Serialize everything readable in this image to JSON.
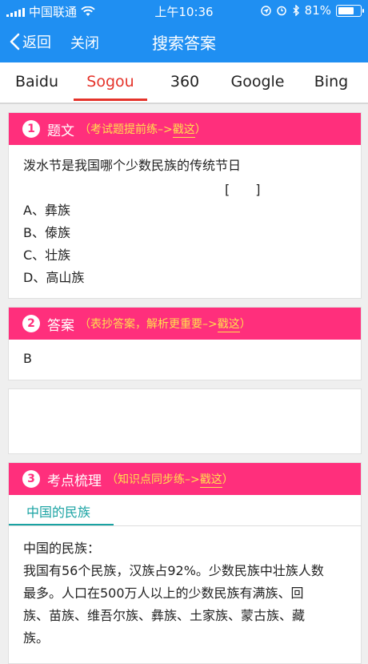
{
  "status_bar": {
    "carrier": "中国联通",
    "time": "上午10:36",
    "battery": "81%",
    "battery_level": 0.81
  },
  "nav": {
    "back_label": "返回",
    "close_label": "关闭",
    "title": "搜索答案"
  },
  "tabs": [
    "Baidu",
    "Sogou",
    "360",
    "Google",
    "Bing"
  ],
  "active_tab": "Sogou",
  "question_card": {
    "number": "1",
    "title": "题文",
    "hint_prefix": "（考试题提前练–>",
    "hint_link": "戳这",
    "hint_suffix": "）",
    "text": "泼水节是我国哪个少数民族的传统节日",
    "blank": "[　　]",
    "options": [
      "A、彝族",
      "B、傣族",
      "C、壮族",
      "D、高山族"
    ]
  },
  "answer_card": {
    "number": "2",
    "title": "答案",
    "hint_prefix": "（表抄答案，解析更重要–>",
    "hint_link": "戳这",
    "hint_suffix": "）",
    "answer": "B"
  },
  "points_card": {
    "number": "3",
    "title": "考点梳理",
    "hint_prefix": "（知识点同步练–>",
    "hint_link": "戳这",
    "hint_suffix": "）",
    "subtab": "中国的民族",
    "lines": [
      "中国的民族：",
      "我国有56个民族，汉族占92%。少数民族中壮族人数",
      "最多。人口在500万人以上的少数民族有满族、回",
      "族、苗族、维吾尔族、彝族、土家族、蒙古族、藏",
      "族。"
    ]
  }
}
